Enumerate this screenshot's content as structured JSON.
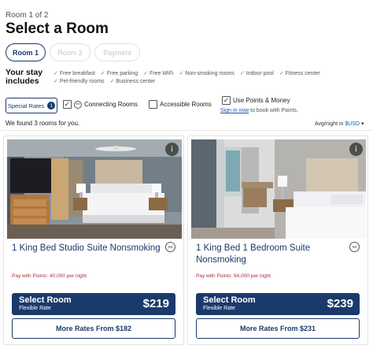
{
  "header": {
    "room_counter": "Room 1 of 2",
    "title": "Select a Room"
  },
  "steps": [
    {
      "label": "Room 1",
      "state": "active"
    },
    {
      "label": "Room 2",
      "state": "disabled"
    },
    {
      "label": "Payment",
      "state": "disabled"
    }
  ],
  "stay": {
    "heading_line1": "Your stay",
    "heading_line2": "includes",
    "amenities": [
      "Free breakfast",
      "Free parking",
      "Free WiFi",
      "Non-smoking rooms",
      "Indoor pool",
      "Fitness center",
      "Pet-friendly rooms",
      "Business center"
    ]
  },
  "filters": {
    "special_rates_label": "Special Rates",
    "special_rates_count": "1",
    "connecting_rooms": {
      "label": "Connecting Rooms",
      "checked": true
    },
    "accessible_rooms": {
      "label": "Accessible Rooms",
      "checked": false
    },
    "use_points": {
      "label": "Use Points & Money",
      "checked": true
    },
    "signin_link": "Sign in now",
    "signin_rest": " to book with Points."
  },
  "results": {
    "found_text": "We found 3 rooms for you.",
    "avg_label": "Avg/night in ",
    "currency": "$USD"
  },
  "rooms": [
    {
      "name": "1 King Bed Studio Suite Nonsmoking",
      "points": "Pay with Points: 40,000 per night",
      "select_label": "Select Room",
      "rate_name": "Flexible Rate",
      "price": "$219",
      "more_rates": "More Rates From $182"
    },
    {
      "name": "1 King Bed 1 Bedroom Suite Nonsmoking",
      "points": "Pay with Points: 94,000 per night",
      "select_label": "Select Room",
      "rate_name": "Flexible Rate",
      "price": "$239",
      "more_rates": "More Rates From $231"
    }
  ],
  "icons": {
    "info": "info-icon",
    "link": "link-icon",
    "check": "checkmark-icon",
    "caret": "caret-down-icon"
  },
  "colors": {
    "brand": "#1a3a6b",
    "points_text": "#a4303a",
    "link": "#1a56b0"
  }
}
